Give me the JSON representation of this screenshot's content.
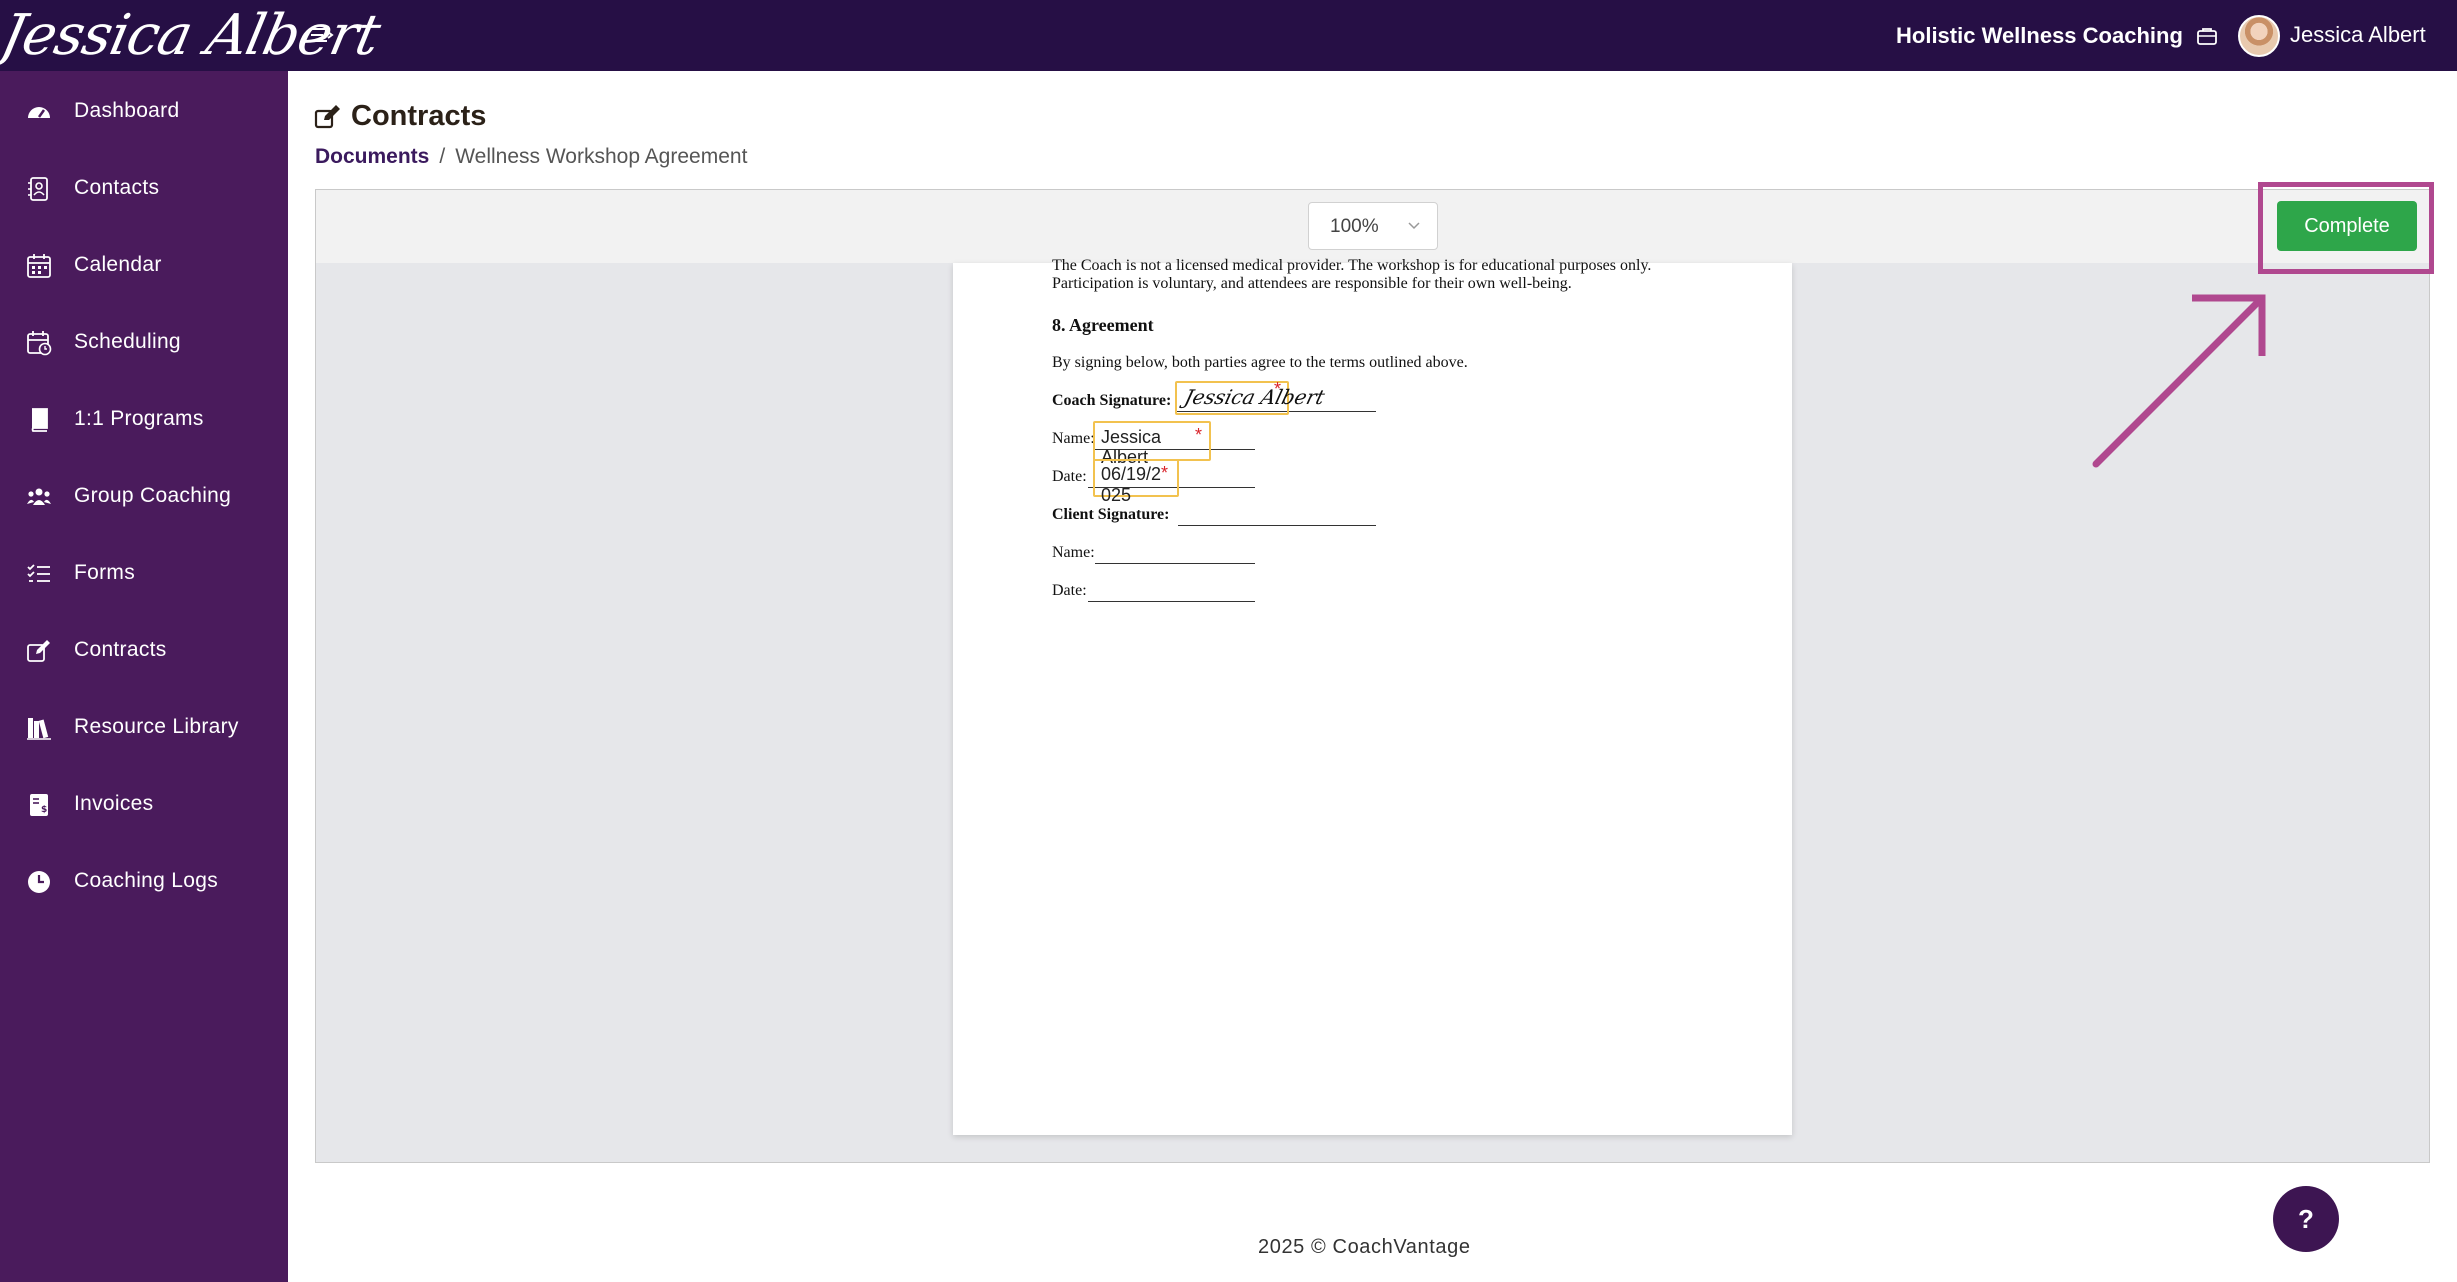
{
  "header": {
    "brand": "Jessica Albert",
    "org_name": "Holistic Wellness Coaching",
    "user_name": "Jessica Albert"
  },
  "sidebar": {
    "items": [
      {
        "label": "Dashboard",
        "icon": "dashboard-icon"
      },
      {
        "label": "Contacts",
        "icon": "contacts-icon"
      },
      {
        "label": "Calendar",
        "icon": "calendar-icon"
      },
      {
        "label": "Scheduling",
        "icon": "scheduling-icon"
      },
      {
        "label": "1:1 Programs",
        "icon": "book-icon"
      },
      {
        "label": "Group Coaching",
        "icon": "group-icon"
      },
      {
        "label": "Forms",
        "icon": "checklist-icon"
      },
      {
        "label": "Contracts",
        "icon": "pen-to-square-icon"
      },
      {
        "label": "Resource Library",
        "icon": "library-icon"
      },
      {
        "label": "Invoices",
        "icon": "invoice-icon"
      },
      {
        "label": "Coaching Logs",
        "icon": "clock-icon"
      }
    ]
  },
  "page": {
    "title": "Contracts",
    "breadcrumb": {
      "parent": "Documents",
      "separator": "/",
      "current": "Wellness Workshop Agreement"
    }
  },
  "viewer": {
    "zoom": "100%",
    "complete_label": "Complete"
  },
  "document": {
    "disclaimer_line1": "The Coach is not a licensed medical provider. The workshop is for educational purposes only.",
    "disclaimer_line2": "Participation is voluntary, and attendees are responsible for their own well-being.",
    "section_heading": "8. Agreement",
    "agreement_text": "By signing below, both parties agree to the terms outlined above.",
    "coach_signature_label": "Coach Signature:",
    "name_label": "Name:",
    "date_label": "Date:",
    "client_signature_label": "Client Signature:",
    "coach_signature_value": "Jessica Albert",
    "coach_name_value_line1": "Jessica",
    "coach_name_value_line2": "Albert",
    "coach_date_value_line1": "06/19/2",
    "coach_date_value_line2": "025",
    "required_marker": "*"
  },
  "footer": {
    "text": "2025 © CoachVantage"
  },
  "help": {
    "label": "?"
  },
  "colors": {
    "topbar": "#260f45",
    "sidebar": "#4a1b5c",
    "complete": "#2ea64a",
    "highlight": "#b0488f",
    "field_border": "#f2c24f"
  }
}
